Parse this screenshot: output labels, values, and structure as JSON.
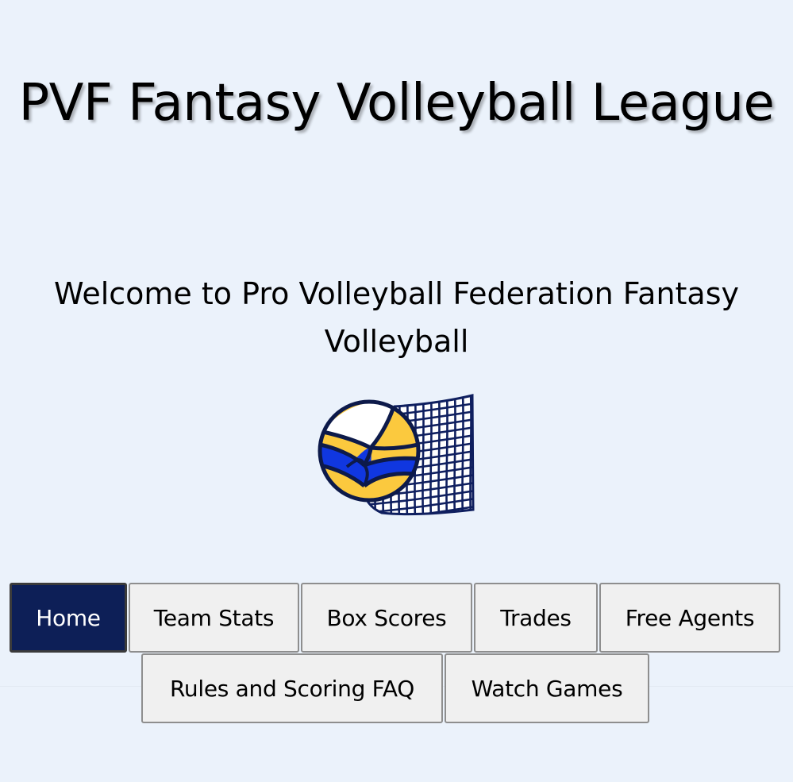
{
  "header": {
    "title": "PVF Fantasy Volleyball League",
    "welcome": "Welcome to Pro Volleyball Federation Fantasy Volleyball"
  },
  "logo": {
    "icon": "volleyball-with-net-icon",
    "colors": {
      "ball_yellow": "#fbc93e",
      "ball_blue": "#1037e0",
      "ball_white": "#ffffff",
      "net": "#0f1f5f",
      "outline": "#0d1a4a"
    }
  },
  "nav": {
    "active_color": "#0d1f57",
    "items": [
      {
        "label": "Home",
        "active": true
      },
      {
        "label": "Team Stats",
        "active": false
      },
      {
        "label": "Box Scores",
        "active": false
      },
      {
        "label": "Trades",
        "active": false
      },
      {
        "label": "Free Agents",
        "active": false
      },
      {
        "label": "Rules and Scoring FAQ",
        "active": false
      },
      {
        "label": "Watch Games",
        "active": false
      }
    ]
  }
}
